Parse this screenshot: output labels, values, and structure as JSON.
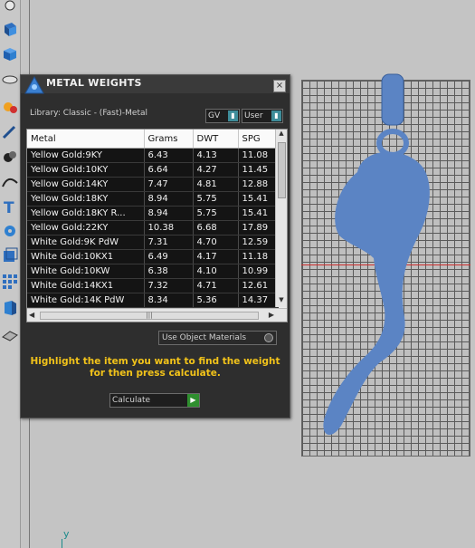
{
  "panel": {
    "title": "METAL WEIGHTS",
    "close_label": "×",
    "library_label": "Library: Classic - (Fast)-Metal",
    "gv_label": "GV",
    "user_label": "User",
    "use_object_materials_label": "Use Object Materials",
    "instructions": "Highlight the item you want to find the weight for then press calculate.",
    "calculate_label": "Calculate"
  },
  "table": {
    "headers": [
      "Metal",
      "Grams",
      "DWT",
      "SPG"
    ],
    "rows": [
      [
        "Yellow Gold:9KY",
        "6.43",
        "4.13",
        "11.08"
      ],
      [
        "Yellow Gold:10KY",
        "6.64",
        "4.27",
        "11.45"
      ],
      [
        "Yellow Gold:14KY",
        "7.47",
        "4.81",
        "12.88"
      ],
      [
        "Yellow Gold:18KY",
        "8.94",
        "5.75",
        "15.41"
      ],
      [
        "Yellow Gold:18KY R...",
        "8.94",
        "5.75",
        "15.41"
      ],
      [
        "Yellow Gold:22KY",
        "10.38",
        "6.68",
        "17.89"
      ],
      [
        "White Gold:9K PdW",
        "7.31",
        "4.70",
        "12.59"
      ],
      [
        "White Gold:10KX1",
        "6.49",
        "4.17",
        "11.18"
      ],
      [
        "White Gold:10KW",
        "6.38",
        "4.10",
        "10.99"
      ],
      [
        "White Gold:14KX1",
        "7.32",
        "4.71",
        "12.61"
      ],
      [
        "White Gold:14K PdW",
        "8.34",
        "5.36",
        "14.37"
      ]
    ]
  },
  "viewport": {
    "axis_label": "y"
  },
  "colors": {
    "accent": "#3e8d9a",
    "instruction_text": "#f2c31a",
    "model_fill": "#5b84c4",
    "axis_red": "#d03030"
  },
  "icons": [
    "shape-icon",
    "box-icon",
    "sphere-icon",
    "metal-weights-icon",
    "material-icon",
    "curve-icon",
    "text-icon",
    "gear-icon",
    "cube-icon",
    "array-icon",
    "prism-icon",
    "plane-icon"
  ]
}
